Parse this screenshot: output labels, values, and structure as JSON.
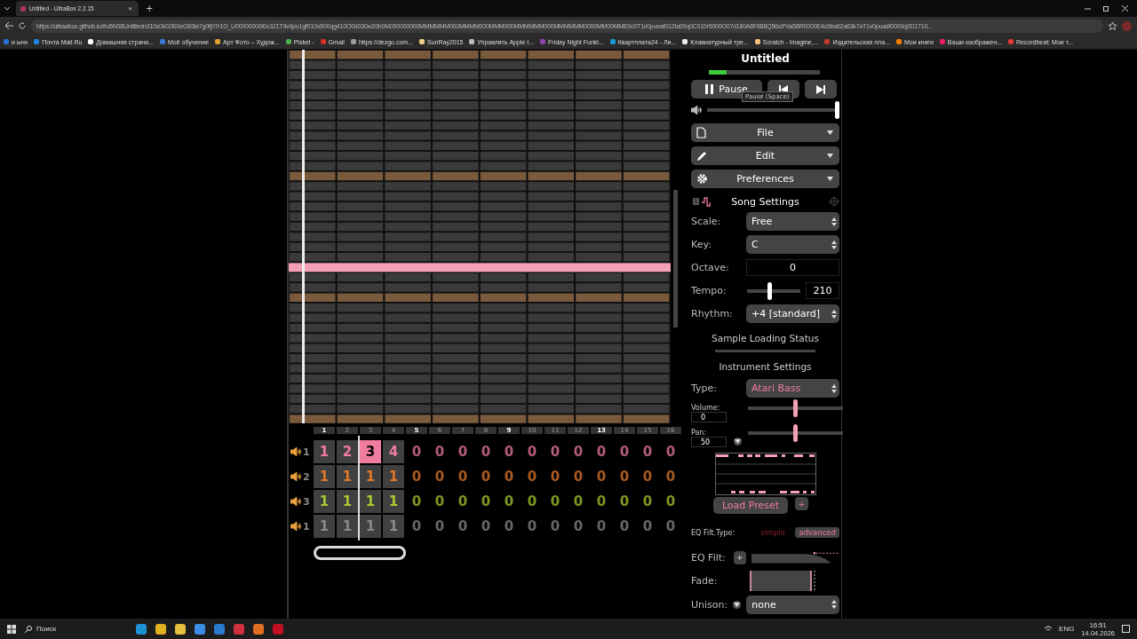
{
  "browser": {
    "tab_title": "Untitled - UltraBox 2.2.15",
    "tab_close": "×",
    "new_tab": "+",
    "url": "https://ultraabox.github.io/#u5N08Untitledn310s0k02l00e03t3ia7g0fj07r1O_U00000000i0o321T9v0pu1gf010o500qg410O0d030w20h0M000000000MMMMMM000MMMM000MMM000MMMMMM000MMMMMM0000MM00MME0c0T1v0pueaf012ta00q0C010r5000O07d180A8F888Q56ciPda58R0000E4c0ba62a63k7aT1v0puadf0000q0D1710...",
    "bookmarks": [
      {
        "label": "и ынх",
        "color": "#2a6fd6"
      },
      {
        "label": "Почта Mail.Ru",
        "color": "#1e88e5"
      },
      {
        "label": "Домашняя страни...",
        "color": "#ffffff"
      },
      {
        "label": "Моё обучение",
        "color": "#3a7bd5"
      },
      {
        "label": "Арт Фото – Худож...",
        "color": "#e0a030"
      },
      {
        "label": "Piskel -",
        "color": "#4caf50"
      },
      {
        "label": "Gmail",
        "color": "#d93025"
      },
      {
        "label": "https://dezgo.com...",
        "color": "#9e9e9e"
      },
      {
        "label": "SunRay2015",
        "color": "#f2d08a"
      },
      {
        "label": "Управлять Apple I...",
        "color": "#bdbdbd"
      },
      {
        "label": "Friday Night Funki...",
        "color": "#8e44ad"
      },
      {
        "label": "Квартплата24 - Ли...",
        "color": "#1a9bd7"
      },
      {
        "label": "Клавиатурный тре...",
        "color": "#eeeeee"
      },
      {
        "label": "Scratch - Imagine,...",
        "color": "#f6c27a"
      },
      {
        "label": "Издательская пла...",
        "color": "#c0392b"
      },
      {
        "label": "Мои книги",
        "color": "#f57c00"
      },
      {
        "label": "Ваши изображен...",
        "color": "#e91e63"
      },
      {
        "label": "Recordbeat: Мои т...",
        "color": "#e53935"
      }
    ]
  },
  "track_editor": {
    "bar_numbers": [
      {
        "label": "1",
        "bold": true
      },
      {
        "label": "2",
        "bold": false
      },
      {
        "label": "3",
        "bold": false
      },
      {
        "label": "4",
        "bold": false
      },
      {
        "label": "5",
        "bold": true
      },
      {
        "label": "6",
        "bold": false
      },
      {
        "label": "7",
        "bold": false
      },
      {
        "label": "8",
        "bold": false
      },
      {
        "label": "9",
        "bold": true
      },
      {
        "label": "10",
        "bold": false
      },
      {
        "label": "11",
        "bold": false
      },
      {
        "label": "12",
        "bold": false
      },
      {
        "label": "13",
        "bold": true
      },
      {
        "label": "14",
        "bold": false
      },
      {
        "label": "15",
        "bold": false
      },
      {
        "label": "16",
        "bold": false
      }
    ],
    "channels": [
      {
        "number": "1",
        "color": "#f07ca0",
        "cells": [
          {
            "value": "1",
            "filled": true,
            "selected": false
          },
          {
            "value": "2",
            "filled": true,
            "selected": false
          },
          {
            "value": "3",
            "filled": true,
            "selected": true
          },
          {
            "value": "4",
            "filled": true,
            "selected": false
          },
          {
            "value": "0",
            "filled": false,
            "selected": false
          },
          {
            "value": "0",
            "filled": false,
            "selected": false
          },
          {
            "value": "0",
            "filled": false,
            "selected": false
          },
          {
            "value": "0",
            "filled": false,
            "selected": false
          },
          {
            "value": "0",
            "filled": false,
            "selected": false
          },
          {
            "value": "0",
            "filled": false,
            "selected": false
          },
          {
            "value": "0",
            "filled": false,
            "selected": false
          },
          {
            "value": "0",
            "filled": false,
            "selected": false
          },
          {
            "value": "0",
            "filled": false,
            "selected": false
          },
          {
            "value": "0",
            "filled": false,
            "selected": false
          },
          {
            "value": "0",
            "filled": false,
            "selected": false
          },
          {
            "value": "0",
            "filled": false,
            "selected": false
          }
        ]
      },
      {
        "number": "2",
        "color": "#e0782a",
        "cells": [
          {
            "value": "1",
            "filled": true,
            "selected": false
          },
          {
            "value": "1",
            "filled": true,
            "selected": false
          },
          {
            "value": "1",
            "filled": true,
            "selected": false
          },
          {
            "value": "1",
            "filled": true,
            "selected": false
          },
          {
            "value": "0",
            "filled": false,
            "selected": false
          },
          {
            "value": "0",
            "filled": false,
            "selected": false
          },
          {
            "value": "0",
            "filled": false,
            "selected": false
          },
          {
            "value": "0",
            "filled": false,
            "selected": false
          },
          {
            "value": "0",
            "filled": false,
            "selected": false
          },
          {
            "value": "0",
            "filled": false,
            "selected": false
          },
          {
            "value": "0",
            "filled": false,
            "selected": false
          },
          {
            "value": "0",
            "filled": false,
            "selected": false
          },
          {
            "value": "0",
            "filled": false,
            "selected": false
          },
          {
            "value": "0",
            "filled": false,
            "selected": false
          },
          {
            "value": "0",
            "filled": false,
            "selected": false
          },
          {
            "value": "0",
            "filled": false,
            "selected": false
          }
        ]
      },
      {
        "number": "3",
        "color": "#a8c830",
        "cells": [
          {
            "value": "1",
            "filled": true,
            "selected": false
          },
          {
            "value": "1",
            "filled": true,
            "selected": false
          },
          {
            "value": "1",
            "filled": true,
            "selected": false
          },
          {
            "value": "1",
            "filled": true,
            "selected": false
          },
          {
            "value": "0",
            "filled": false,
            "selected": false
          },
          {
            "value": "0",
            "filled": false,
            "selected": false
          },
          {
            "value": "0",
            "filled": false,
            "selected": false
          },
          {
            "value": "0",
            "filled": false,
            "selected": false
          },
          {
            "value": "0",
            "filled": false,
            "selected": false
          },
          {
            "value": "0",
            "filled": false,
            "selected": false
          },
          {
            "value": "0",
            "filled": false,
            "selected": false
          },
          {
            "value": "0",
            "filled": false,
            "selected": false
          },
          {
            "value": "0",
            "filled": false,
            "selected": false
          },
          {
            "value": "0",
            "filled": false,
            "selected": false
          },
          {
            "value": "0",
            "filled": false,
            "selected": false
          },
          {
            "value": "0",
            "filled": false,
            "selected": false
          }
        ]
      },
      {
        "number": "1",
        "color": "#8a8a8a",
        "cells": [
          {
            "value": "1",
            "filled": true,
            "selected": false
          },
          {
            "value": "1",
            "filled": true,
            "selected": false
          },
          {
            "value": "1",
            "filled": true,
            "selected": false
          },
          {
            "value": "1",
            "filled": true,
            "selected": false
          },
          {
            "value": "0",
            "filled": false,
            "selected": false
          },
          {
            "value": "0",
            "filled": false,
            "selected": false
          },
          {
            "value": "0",
            "filled": false,
            "selected": false
          },
          {
            "value": "0",
            "filled": false,
            "selected": false
          },
          {
            "value": "0",
            "filled": false,
            "selected": false
          },
          {
            "value": "0",
            "filled": false,
            "selected": false
          },
          {
            "value": "0",
            "filled": false,
            "selected": false
          },
          {
            "value": "0",
            "filled": false,
            "selected": false
          },
          {
            "value": "0",
            "filled": false,
            "selected": false
          },
          {
            "value": "0",
            "filled": false,
            "selected": false
          },
          {
            "value": "0",
            "filled": false,
            "selected": false
          },
          {
            "value": "0",
            "filled": false,
            "selected": false
          }
        ]
      }
    ]
  },
  "song": {
    "title": "Untitled",
    "progress": {
      "level": 0.16
    },
    "play_button": "Pause",
    "tooltip": "Pause (Space)",
    "volume": {
      "level": 1
    },
    "menus": [
      "File",
      "Edit",
      "Preferences"
    ]
  },
  "song_settings": {
    "badge": "1",
    "title": "Song Settings",
    "scale": {
      "label": "Scale:",
      "value": "Free"
    },
    "key": {
      "label": "Key:",
      "value": "C"
    },
    "octave": {
      "label": "Octave:",
      "value": "0"
    },
    "tempo": {
      "label": "Tempo:",
      "value": "210",
      "level": 0.42
    },
    "rhythm": {
      "label": "Rhythm:",
      "value": "+4 [standard]"
    }
  },
  "sample_loading": {
    "title": "Sample Loading Status"
  },
  "instrument_settings": {
    "title": "Instrument Settings",
    "type": {
      "label": "Type:",
      "value": "Atari Bass"
    },
    "volume": {
      "label": "Volume:",
      "value": "0",
      "level": 0.5
    },
    "pan": {
      "label": "Pan:",
      "value": "50",
      "level": 0.5
    },
    "load_preset": "Load Preset",
    "add_preset": "+",
    "eq_type": {
      "label": "EQ Filt.Type:",
      "options": [
        {
          "label": "simple",
          "selected": false
        },
        {
          "label": "advanced",
          "selected": true
        }
      ]
    },
    "eq_filter": {
      "label": "EQ Filt:",
      "add": "+"
    },
    "fade": {
      "label": "Fade:"
    },
    "unison": {
      "label": "Unison:",
      "value": "none"
    }
  },
  "taskbar": {
    "search": "Поиск",
    "language": "ENG",
    "time": "16:51",
    "date": "14.04.2026"
  }
}
